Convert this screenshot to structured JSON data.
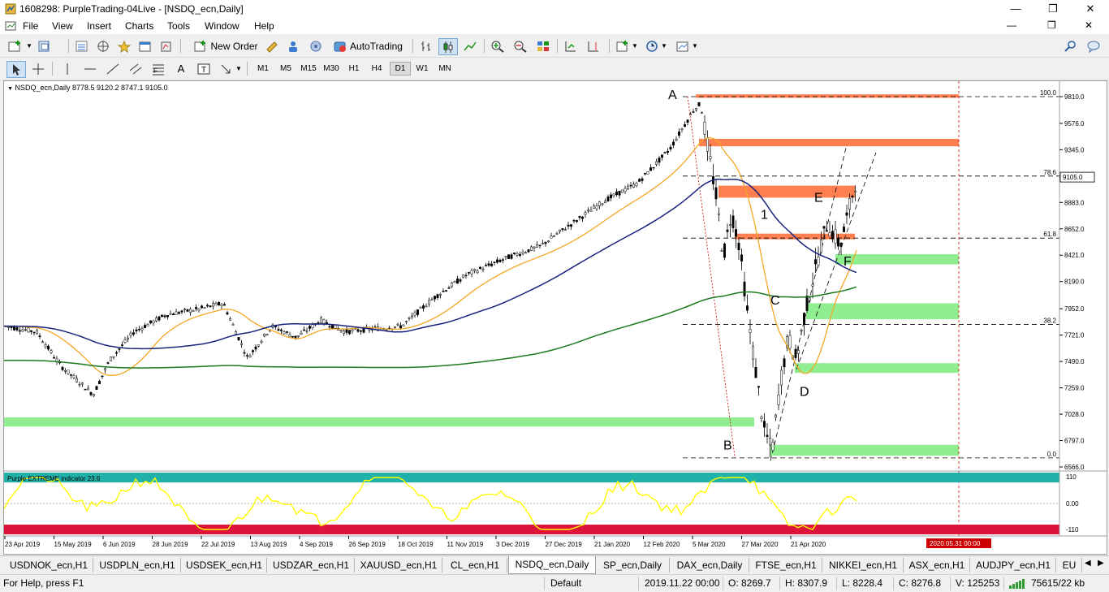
{
  "window": {
    "title": "1608298: PurpleTrading-04Live - [NSDQ_ecn,Daily]"
  },
  "menu": [
    "File",
    "View",
    "Insert",
    "Charts",
    "Tools",
    "Window",
    "Help"
  ],
  "toolbar": {
    "new_order": "New Order",
    "autotrading": "AutoTrading"
  },
  "timeframes": [
    "M1",
    "M5",
    "M15",
    "M30",
    "H1",
    "H4",
    "D1",
    "W1",
    "MN"
  ],
  "active_timeframe": "D1",
  "chart": {
    "header": "NSDQ_ecn,Daily  8778.5 9120.2 8747.1 9105.0",
    "current_price": "9105.0",
    "price_ticks": [
      "9810.0",
      "9576.0",
      "9345.0",
      "9114.0",
      "8883.0",
      "8652.0",
      "8421.0",
      "8190.0",
      "7952.0",
      "7721.0",
      "7490.0",
      "7259.0",
      "7028.0",
      "6797.0",
      "6566.0"
    ],
    "date_ticks": [
      "23 Apr 2019",
      "15 May 2019",
      "6 Jun 2019",
      "28 Jun 2019",
      "22 Jul 2019",
      "13 Aug 2019",
      "4 Sep 2019",
      "26 Sep 2019",
      "18 Oct 2019",
      "11 Nov 2019",
      "3 Dec 2019",
      "27 Dec 2019",
      "21 Jan 2020",
      "12 Feb 2020",
      "5 Mar 2020",
      "27 Mar 2020",
      "21 Apr 2020"
    ],
    "future_date": "2020.05.31 00:00",
    "fib_levels": [
      {
        "label": "100.0",
        "price": 9810
      },
      {
        "label": "78.6",
        "price": 9114
      },
      {
        "label": "61.8",
        "price": 8571
      },
      {
        "label": "38.2",
        "price": 7814
      },
      {
        "label": "0.0",
        "price": 6645
      }
    ],
    "wave_labels": [
      "A",
      "B",
      "C",
      "D",
      "E",
      "F",
      "1"
    ],
    "indicator": {
      "title": "Purple EXTREME indicator 23.6",
      "ticks": [
        "110",
        "0.00",
        "-110"
      ]
    },
    "colors": {
      "resistance": "#ff7f50",
      "support": "#90ee90",
      "ma_fast": "#f5a623",
      "ma_mid": "#1a237e",
      "ma_slow": "#1b7a1b",
      "indicator_line": "#ffff00",
      "indicator_top": "#20b2aa",
      "indicator_bottom": "#dc143c",
      "price_tag": "#cc0000"
    }
  },
  "tabs": [
    "USDNOK_ecn,H1",
    "USDPLN_ecn,H1",
    "USDSEK_ecn,H1",
    "USDZAR_ecn,H1",
    "XAUUSD_ecn,H1",
    "CL_ecn,H1",
    "NSDQ_ecn,Daily",
    "SP_ecn,Daily",
    "DAX_ecn,Daily",
    "FTSE_ecn,H1",
    "NIKKEI_ecn,H1",
    "ASX_ecn,H1",
    "AUDJPY_ecn,H1",
    "EU"
  ],
  "active_tab": "NSDQ_ecn,Daily",
  "status": {
    "help": "For Help, press F1",
    "profile": "Default",
    "datetime": "2019.11.22 00:00",
    "open": "O: 8269.7",
    "high": "H: 8307.9",
    "low": "L: 8228.4",
    "close": "C: 8276.8",
    "volume": "V: 125253",
    "traffic": "75615/22 kb"
  }
}
